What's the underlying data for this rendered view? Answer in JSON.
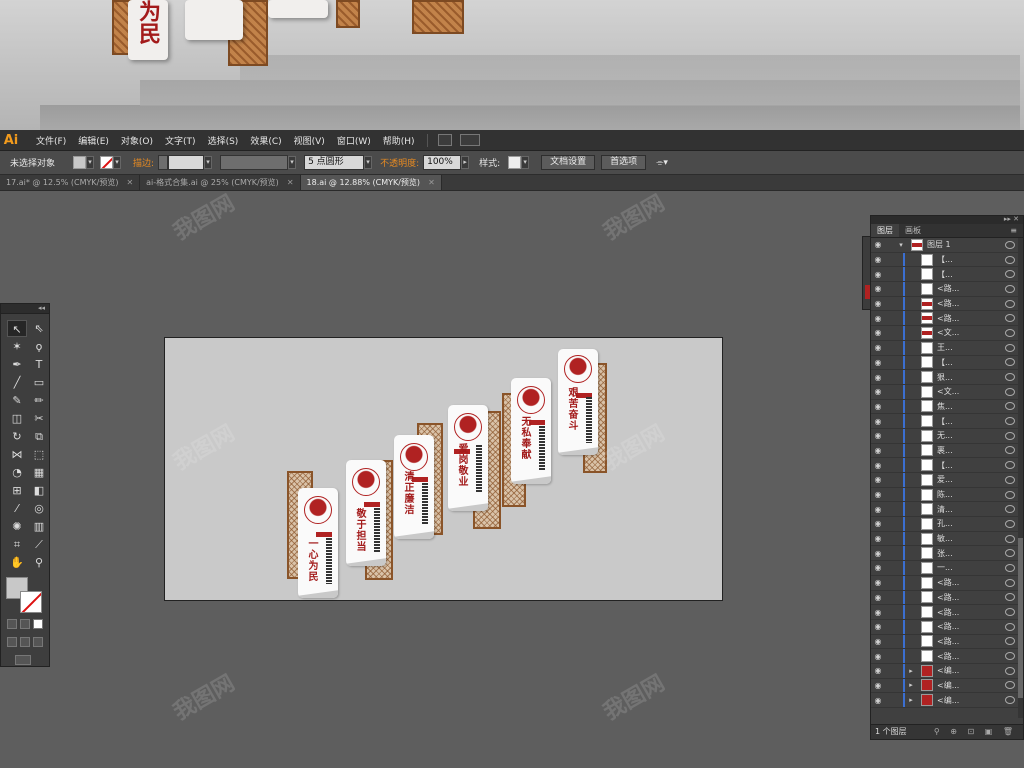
{
  "app": {
    "logo": "Ai"
  },
  "menu": [
    "文件(F)",
    "编辑(E)",
    "对象(O)",
    "文字(T)",
    "选择(S)",
    "效果(C)",
    "视图(V)",
    "窗口(W)",
    "帮助(H)"
  ],
  "control_bar": {
    "selection": "未选择对象",
    "stroke_label": "描边:",
    "brush": "5 点圆形",
    "opacity_label": "不透明度:",
    "opacity_value": "100%",
    "style_label": "样式:",
    "doc_settings": "文档设置",
    "preferences": "首选项"
  },
  "tabs": [
    {
      "label": "17.ai* @ 12.5% (CMYK/预览)",
      "active": false
    },
    {
      "label": "ai-格式合集.ai @ 25% (CMYK/预览)",
      "active": false
    },
    {
      "label": "18.ai @ 12.88% (CMYK/预览)",
      "active": true
    }
  ],
  "layers_panel": {
    "tabs": [
      "图层",
      "画板"
    ],
    "top_layer": "图层 1",
    "rows": [
      "【...",
      "【...",
      "<路...",
      "<路...",
      "<路...",
      "<文...",
      "王...",
      "【...",
      "狠...",
      "<文...",
      "焦...",
      "【...",
      "无...",
      "裹...",
      "【...",
      "爱...",
      "陈...",
      "清...",
      "孔...",
      "敏...",
      "张...",
      "一...",
      "<路...",
      "<路...",
      "<路...",
      "<路...",
      "<路...",
      "<路...",
      "<编...",
      "<编...",
      "<编..."
    ],
    "footer": "1 个图层"
  },
  "artwork": {
    "titles": [
      "一心为民",
      "敬于担当",
      "清正廉洁",
      "爱岗敬业",
      "无私奉献",
      "艰苦奋斗"
    ]
  },
  "banner": {
    "chars": [
      "为民"
    ]
  },
  "watermark": "我图网"
}
